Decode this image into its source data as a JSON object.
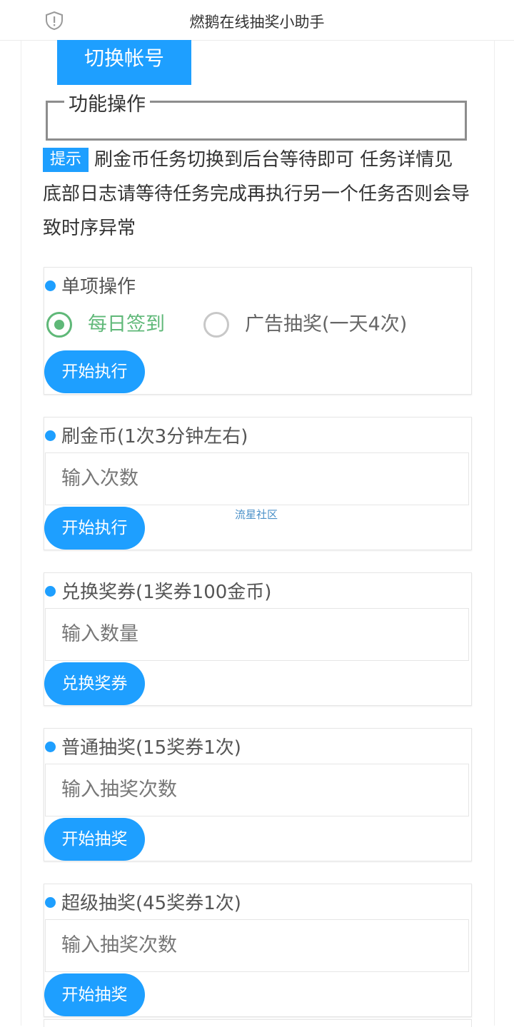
{
  "header": {
    "title": "燃鹅在线抽奖小助手",
    "icon": "shield-alert-icon"
  },
  "switch_account_label": "切换帐号",
  "fieldset_legend": "功能操作",
  "tip": {
    "badge": "提示",
    "text": "刷金币任务切换到后台等待即可 任务详情见底部日志请等待任务完成再执行另一个任务否则会导致时序异常"
  },
  "single_op": {
    "title": "单项操作",
    "options": [
      {
        "label": "每日签到",
        "selected": true
      },
      {
        "label": "广告抽奖(一天4次)",
        "selected": false
      }
    ],
    "button": "开始执行"
  },
  "coins": {
    "title": "刷金币(1次3分钟左右)",
    "placeholder": "输入次数",
    "button": "开始执行"
  },
  "watermark": "流星社区",
  "exchange": {
    "title": "兑换奖券(1奖券100金币)",
    "placeholder": "输入数量",
    "button": "兑换奖券"
  },
  "normal_draw": {
    "title": "普通抽奖(15奖券1次)",
    "placeholder": "输入抽奖次数",
    "button": "开始抽奖"
  },
  "super_draw": {
    "title": "超级抽奖(45奖券1次)",
    "placeholder": "输入抽奖次数",
    "button": "开始抽奖"
  },
  "colors": {
    "primary": "#1e9fff",
    "green": "#5fb878"
  }
}
